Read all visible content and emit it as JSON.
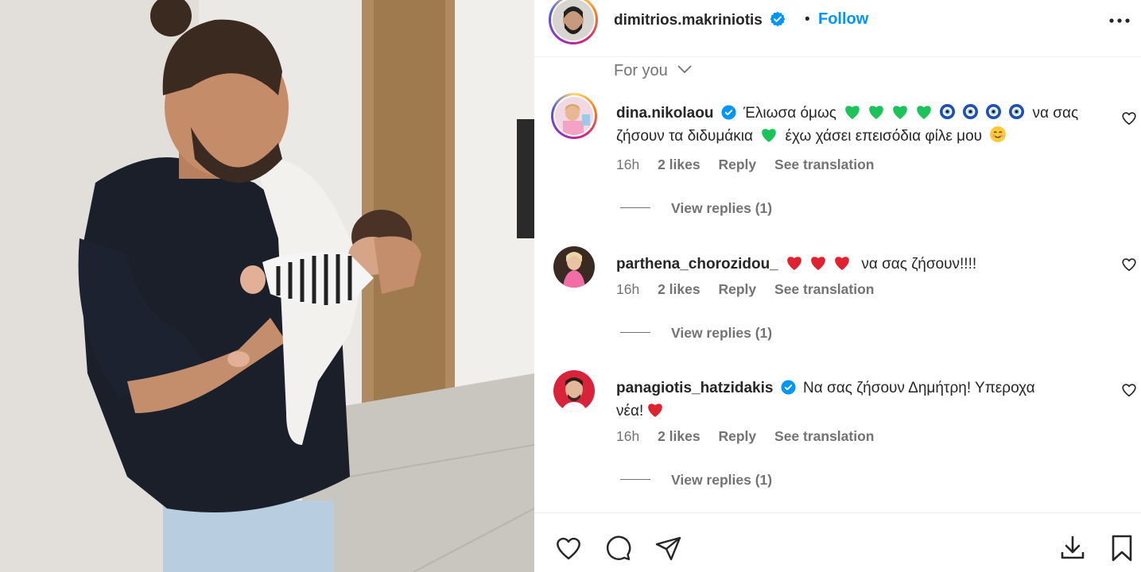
{
  "post": {
    "owner_username": "dimitrios.makriniotis",
    "separator": "•",
    "follow_label": "Follow",
    "feed_filter": "For you",
    "photo_alt_icon": "post-photo"
  },
  "comments": [
    {
      "username": "dina.nikolaou",
      "verified": true,
      "text_1": "Έλιωσα όμως",
      "text_2": "να σας",
      "text_3": "ζήσουν τα διδυμάκια",
      "text_4": "έχω χάσει επεισόδια φίλε μου",
      "time": "16h",
      "likes": "2 likes",
      "reply_label": "Reply",
      "translation_label": "See translation",
      "view_replies": "View replies (1)"
    },
    {
      "username": "parthena_chorozidou_",
      "verified": false,
      "text_1": "να σας ζήσουν!!!!",
      "time": "16h",
      "likes": "2 likes",
      "reply_label": "Reply",
      "translation_label": "See translation",
      "view_replies": "View replies (1)"
    },
    {
      "username": "panagiotis_hatzidakis",
      "verified": true,
      "text_1": "Να σας ζήσουν Δημήτρη! Υπεροχα",
      "text_2": "νέα!",
      "time": "16h",
      "likes": "2 likes",
      "reply_label": "Reply",
      "translation_label": "See translation",
      "view_replies": "View replies (1)"
    }
  ],
  "colors": {
    "follow": "#0095f6",
    "verified": "#0095f6",
    "muted": "#737373",
    "text": "#262626",
    "green_heart": "#1bc35a",
    "red_heart": "#e0212f",
    "nazar": "#1e4fb5"
  },
  "icons": [
    "verified-icon",
    "more-options-icon",
    "chevron-down-icon",
    "heart-icon",
    "comment-icon",
    "share-icon",
    "download-icon",
    "bookmark-icon",
    "green-heart-emoji",
    "nazar-emoji",
    "red-heart-emoji",
    "smiling-face-emoji"
  ]
}
